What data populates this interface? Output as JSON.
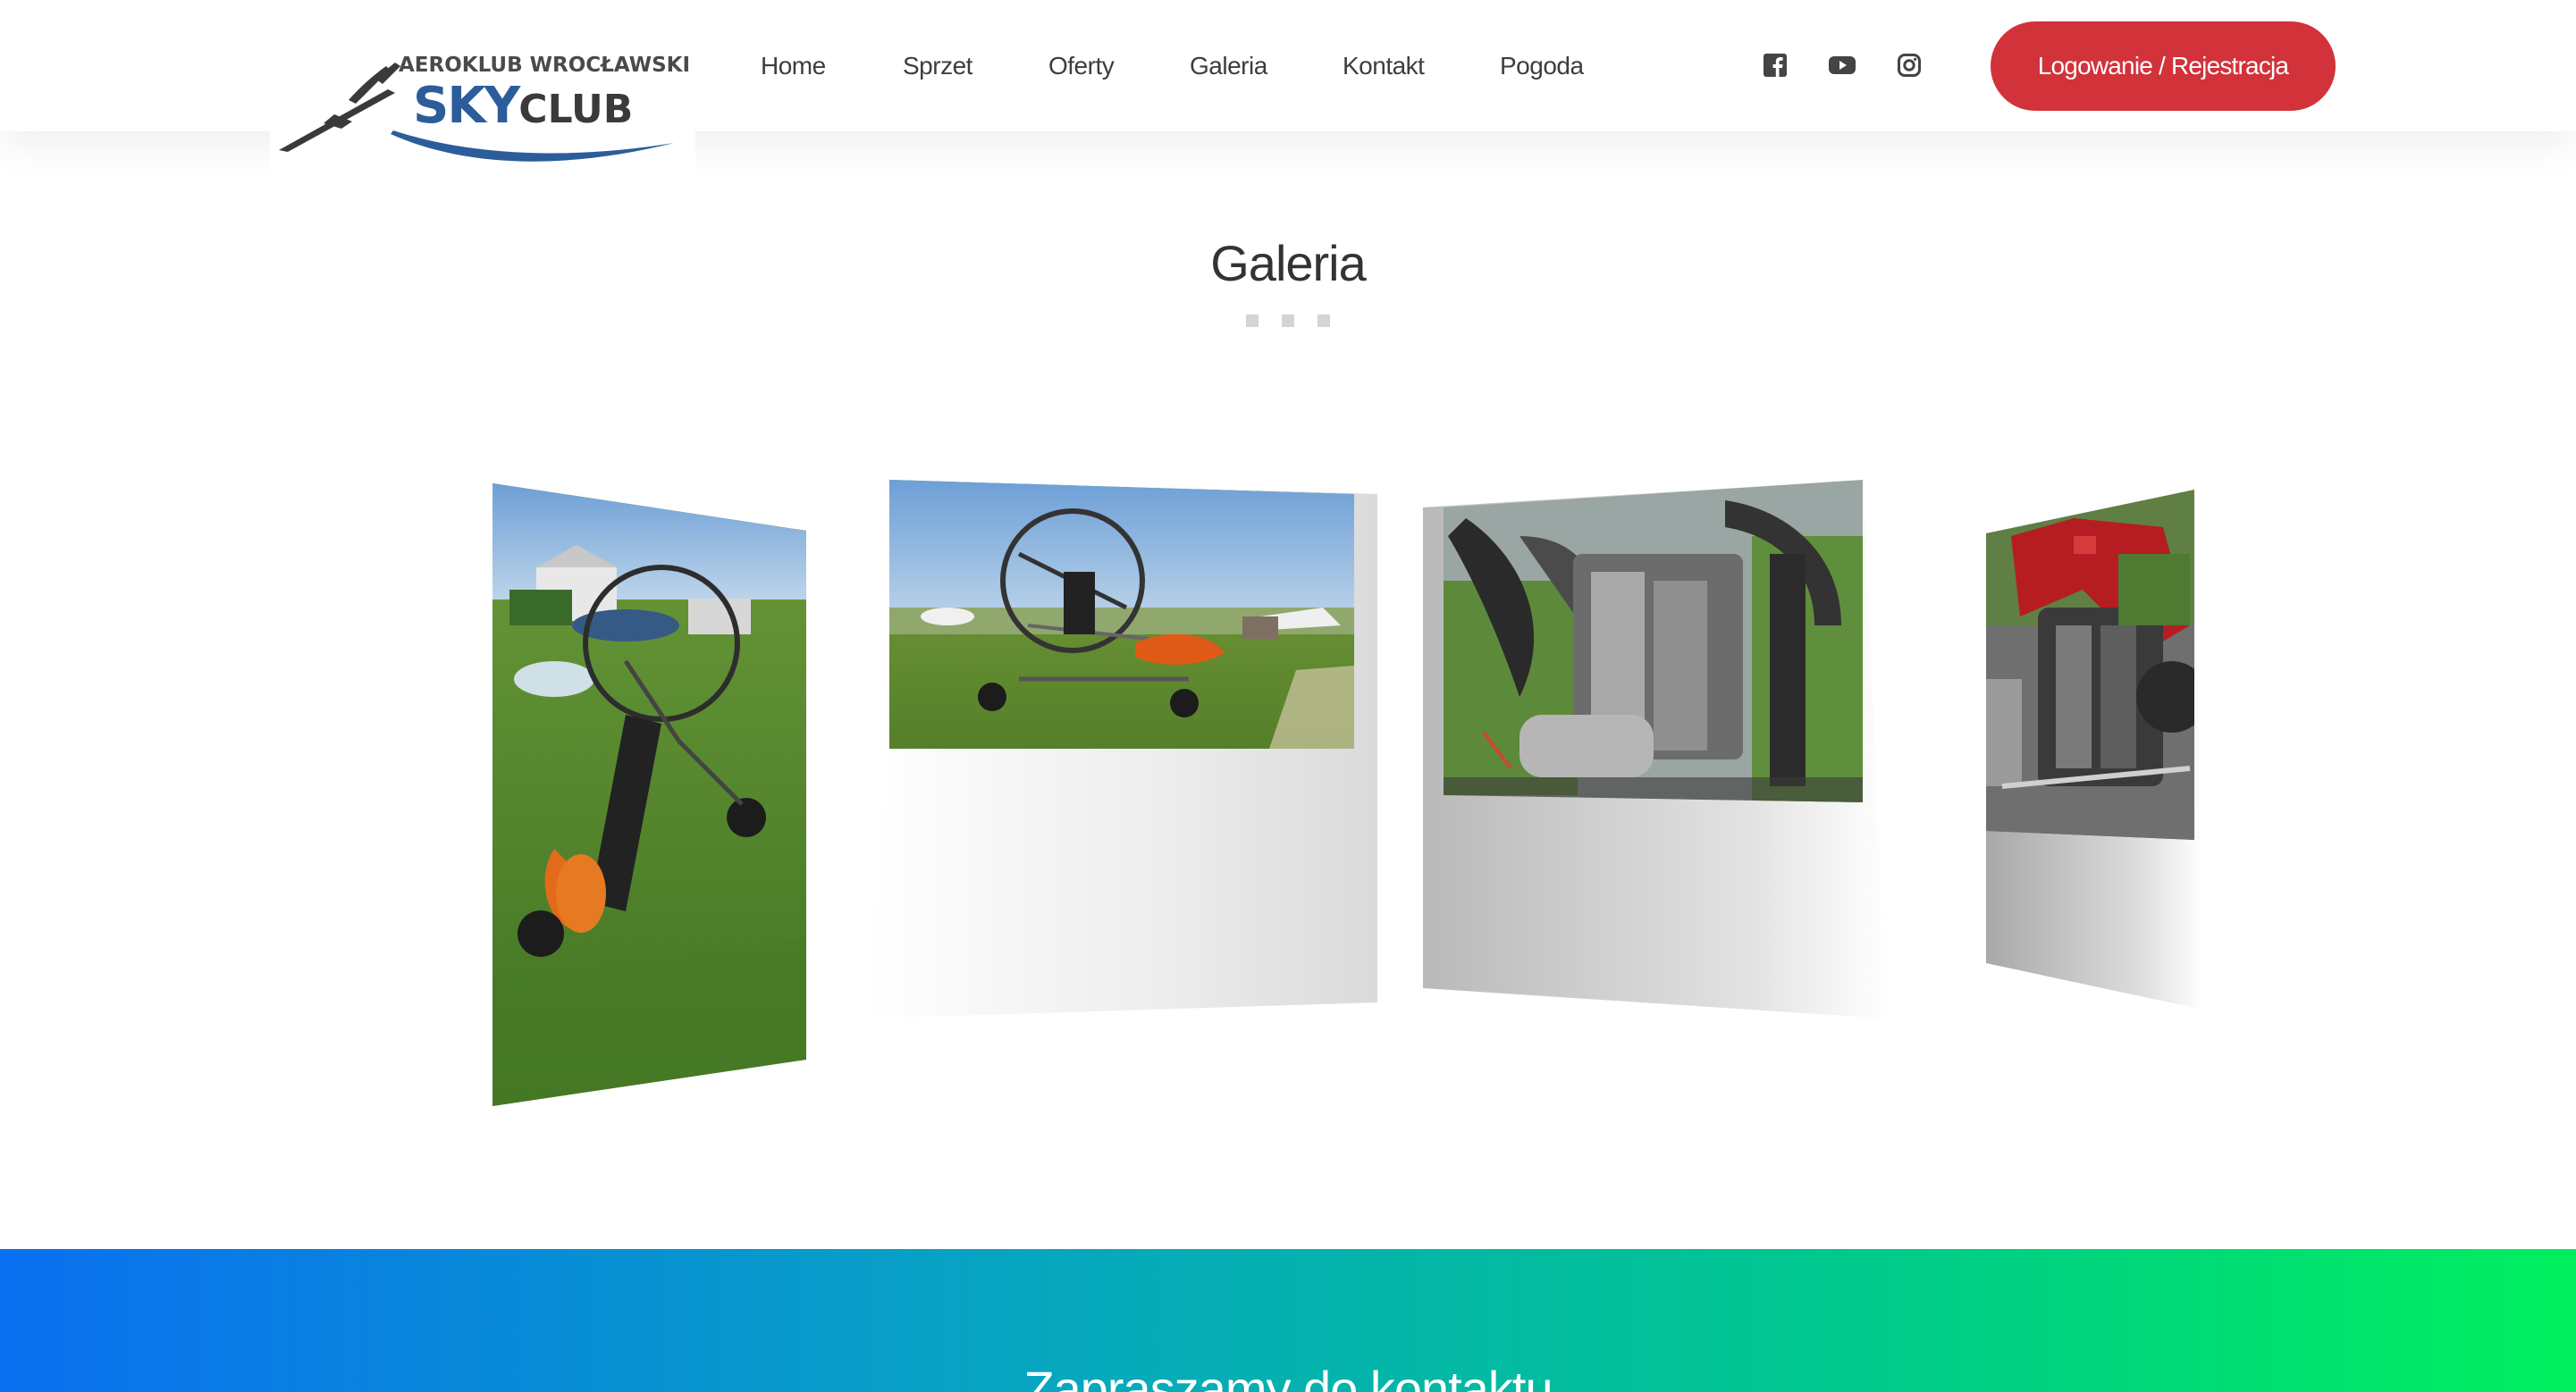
{
  "header": {
    "logo": {
      "top_text": "AEROKLUB WROCŁAWSKI",
      "brand_main": "SKY",
      "brand_sub": "CLUB"
    },
    "nav": [
      {
        "label": "Home"
      },
      {
        "label": "Sprzet"
      },
      {
        "label": "Oferty"
      },
      {
        "label": "Galeria"
      },
      {
        "label": "Kontakt"
      },
      {
        "label": "Pogoda"
      }
    ],
    "social_icons": [
      "facebook-icon",
      "youtube-icon",
      "instagram-icon"
    ],
    "login_button": "Logowanie / Rejestracja"
  },
  "gallery_section": {
    "title": "Galeria",
    "dots_count": 3,
    "images": [
      {
        "name": "gallery-image-paratrike-grass"
      },
      {
        "name": "gallery-image-paratrike-airfield"
      },
      {
        "name": "gallery-image-engine-closeup"
      },
      {
        "name": "gallery-image-engine-red-frame"
      }
    ]
  },
  "contact_section": {
    "title": "Zapraszamy do kontaktu"
  },
  "colors": {
    "accent_red": "#d2323a",
    "brand_blue": "#2c5d9a",
    "gradient_start": "#0a6ff0",
    "gradient_end": "#00ef5e"
  }
}
